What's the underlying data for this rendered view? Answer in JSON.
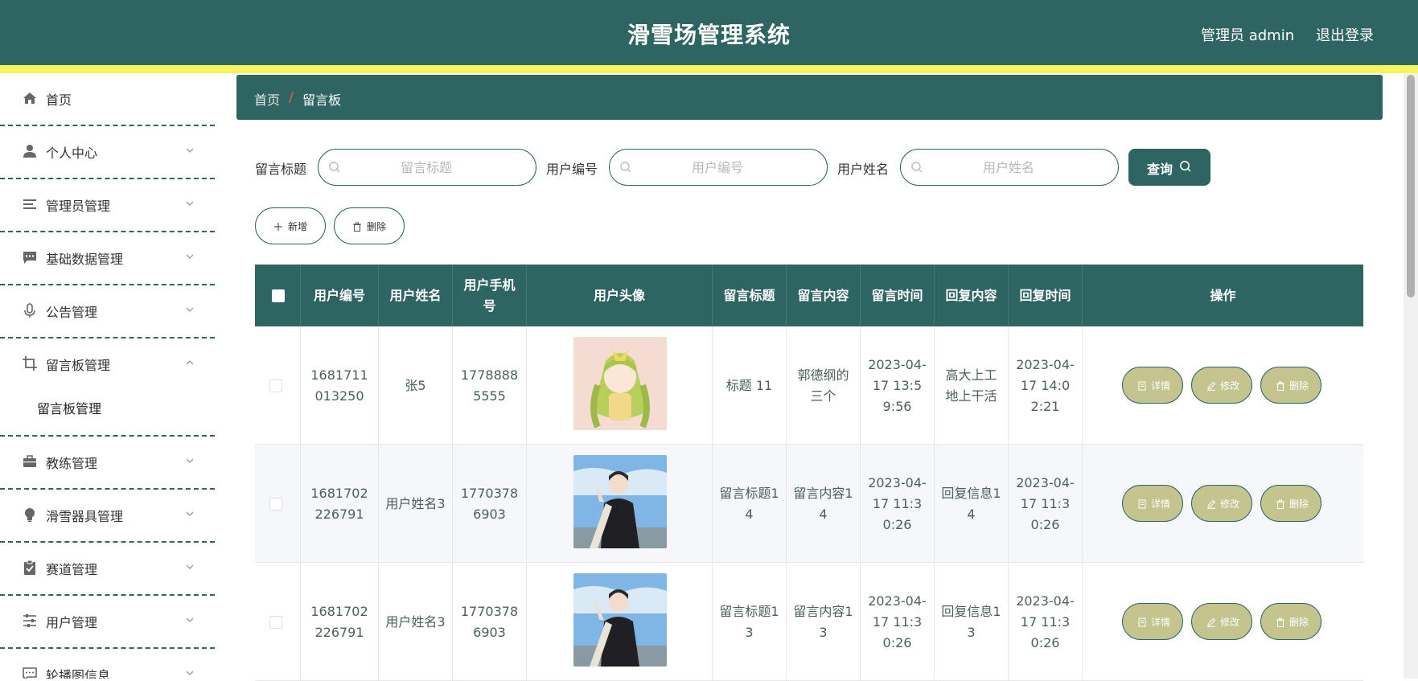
{
  "header": {
    "title": "滑雪场管理系统",
    "admin_label": "管理员 admin",
    "logout_label": "退出登录"
  },
  "sidebar": {
    "items": [
      {
        "label": "首页",
        "icon": "home-icon"
      },
      {
        "label": "个人中心",
        "icon": "user-icon"
      },
      {
        "label": "管理员管理",
        "icon": "list-icon"
      },
      {
        "label": "基础数据管理",
        "icon": "chat-icon"
      },
      {
        "label": "公告管理",
        "icon": "microphone-icon"
      },
      {
        "label": "留言板管理",
        "icon": "crop-icon",
        "expanded": true,
        "submenu": [
          "留言板管理"
        ]
      },
      {
        "label": "教练管理",
        "icon": "briefcase-icon"
      },
      {
        "label": "滑雪器具管理",
        "icon": "bulb-icon"
      },
      {
        "label": "赛道管理",
        "icon": "clipboard-icon"
      },
      {
        "label": "用户管理",
        "icon": "sliders-icon"
      },
      {
        "label": "轮播图信息",
        "icon": "message-icon"
      }
    ]
  },
  "breadcrumb": {
    "home": "首页",
    "separator": "/",
    "current": "留言板"
  },
  "search": {
    "fields": [
      {
        "label": "留言标题",
        "placeholder": "留言标题",
        "value": ""
      },
      {
        "label": "用户编号",
        "placeholder": "用户编号",
        "value": ""
      },
      {
        "label": "用户姓名",
        "placeholder": "用户姓名",
        "value": ""
      }
    ],
    "query_label": "查询"
  },
  "actions": {
    "add_label": "新增",
    "delete_label": "删除"
  },
  "table": {
    "headers": [
      "用户编号",
      "用户姓名",
      "用户手机号",
      "用户头像",
      "留言标题",
      "留言内容",
      "留言时间",
      "回复内容",
      "回复时间",
      "操作"
    ],
    "row_buttons": {
      "detail": "详情",
      "edit": "修改",
      "delete": "删除"
    },
    "rows": [
      {
        "user_id": "1681711013250",
        "user_name": "张5",
        "phone": "17788885555",
        "avatar": "anime-girl-avatar",
        "title": "标题 11",
        "content": "郭德纲的三个",
        "time": "2023-04-17 13:59:56",
        "reply": "高大上工地上干活",
        "reply_time": "2023-04-17 14:02:21"
      },
      {
        "user_id": "1681702226791",
        "user_name": "用户姓名3",
        "phone": "17703786903",
        "avatar": "person-photo-avatar",
        "title": "留言标题14",
        "content": "留言内容14",
        "time": "2023-04-17 11:30:26",
        "reply": "回复信息14",
        "reply_time": "2023-04-17 11:30:26"
      },
      {
        "user_id": "1681702226791",
        "user_name": "用户姓名3",
        "phone": "17703786903",
        "avatar": "person-photo-avatar",
        "title": "留言标题13",
        "content": "留言内容13",
        "time": "2023-04-17 11:30:26",
        "reply": "回复信息13",
        "reply_time": "2023-04-17 11:30:26"
      }
    ]
  },
  "colors": {
    "primary": "#2e6461",
    "accent_yellow": "#f8f55c",
    "row_button": "#c3c48e",
    "breadcrumb_separator": "#e45656"
  }
}
